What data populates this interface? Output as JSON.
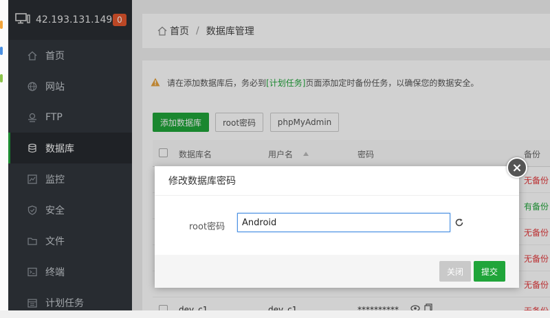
{
  "server": {
    "ip": "42.193.131.149",
    "badge": "0"
  },
  "sidebar": {
    "items": [
      {
        "label": "首页",
        "icon": "home-icon"
      },
      {
        "label": "网站",
        "icon": "globe-icon"
      },
      {
        "label": "FTP",
        "icon": "ftp-icon"
      },
      {
        "label": "数据库",
        "icon": "database-icon",
        "active": true
      },
      {
        "label": "监控",
        "icon": "monitor-icon"
      },
      {
        "label": "安全",
        "icon": "shield-icon"
      },
      {
        "label": "文件",
        "icon": "folder-icon"
      },
      {
        "label": "终端",
        "icon": "terminal-icon"
      },
      {
        "label": "计划任务",
        "icon": "calendar-icon"
      }
    ]
  },
  "breadcrumb": {
    "home": "首页",
    "separator": "/",
    "current": "数据库管理"
  },
  "notice": {
    "before": "请在添加数据库后，务必到",
    "link": "[计划任务]",
    "after": "页面添加定时备份任务，以确保您的数据安全。"
  },
  "toolbar": {
    "add_db": "添加数据库",
    "root_pw": "root密码",
    "phpmyadmin": "phpMyAdmin"
  },
  "table": {
    "headers": {
      "name": "数据库名",
      "user": "用户名",
      "password": "密码",
      "backup": "备份"
    },
    "rows": [
      {
        "backup": "无备份"
      },
      {
        "backup": "有备份"
      },
      {
        "backup": "无备份"
      },
      {
        "backup": "无备份"
      },
      {
        "backup": "无备份"
      },
      {
        "name": "dev_c1",
        "user": "dev_c1",
        "password": "**********",
        "backup": "无备份"
      }
    ]
  },
  "modal": {
    "title": "修改数据库密码",
    "field_label": "root密码",
    "field_value": "Android",
    "cancel_label": "关闭",
    "submit_label": "提交"
  },
  "colors": {
    "accent": "#20a53a",
    "danger": "#e4393c",
    "sidebar": "#31363c"
  }
}
